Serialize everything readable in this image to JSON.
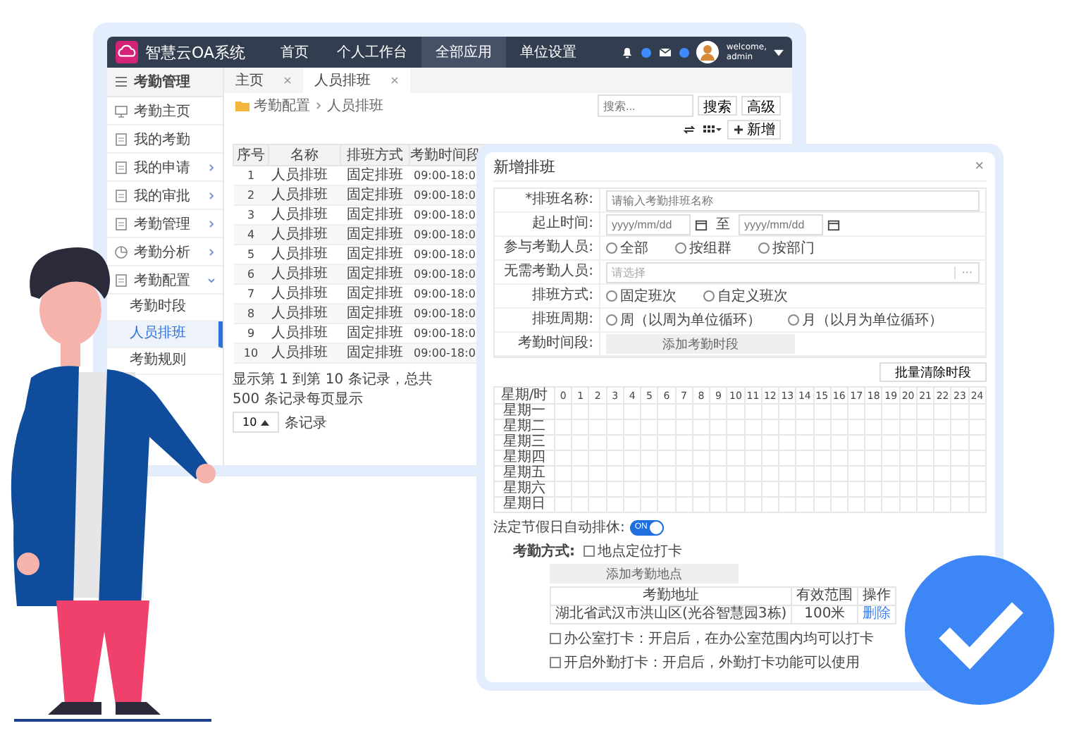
{
  "topbar": {
    "title": "智慧云OA系统",
    "nav": [
      {
        "label": "首页",
        "selected": false
      },
      {
        "label": "个人工作台",
        "selected": false
      },
      {
        "label": "全部应用",
        "selected": true
      },
      {
        "label": "单位设置",
        "selected": false
      }
    ],
    "user": {
      "greeting": "welcome,",
      "name": "admin"
    }
  },
  "sidebar": {
    "title": "考勤管理",
    "items": [
      {
        "label": "考勤主页",
        "kind": "link",
        "selected": false
      },
      {
        "label": "我的考勤",
        "kind": "link",
        "selected": false
      },
      {
        "label": "我的申请",
        "kind": "group",
        "expanded": false,
        "selected": false
      },
      {
        "label": "我的审批",
        "kind": "group",
        "expanded": false,
        "selected": false
      },
      {
        "label": "考勤管理",
        "kind": "group",
        "expanded": false,
        "selected": false
      },
      {
        "label": "考勤分析",
        "kind": "group",
        "expanded": false,
        "selected": false
      },
      {
        "label": "考勤配置",
        "kind": "group",
        "expanded": true,
        "selected": false,
        "children": [
          {
            "label": "考勤时段",
            "selected": false
          },
          {
            "label": "人员排班",
            "selected": true
          },
          {
            "label": "考勤规则",
            "selected": false
          }
        ]
      }
    ]
  },
  "tabs": [
    {
      "label": "主页",
      "selected": false
    },
    {
      "label": "人员排班",
      "selected": true
    }
  ],
  "breadcrumb": [
    "考勤配置",
    "人员排班"
  ],
  "search": {
    "placeholder": "搜索...",
    "button": "搜索",
    "advanced": "高级"
  },
  "toolbar": {
    "add": "新增"
  },
  "table": {
    "columns": [
      "序号",
      "名称",
      "排班方式",
      "考勤时间段"
    ],
    "rows": [
      [
        "1",
        "人员排班",
        "固定排班",
        "09:00-18:0"
      ],
      [
        "2",
        "人员排班",
        "固定排班",
        "09:00-18:0"
      ],
      [
        "3",
        "人员排班",
        "固定排班",
        "09:00-18:0"
      ],
      [
        "4",
        "人员排班",
        "固定排班",
        "09:00-18:0"
      ],
      [
        "5",
        "人员排班",
        "固定排班",
        "09:00-18:0"
      ],
      [
        "6",
        "人员排班",
        "固定排班",
        "09:00-18:0"
      ],
      [
        "7",
        "人员排班",
        "固定排班",
        "09:00-18:0"
      ],
      [
        "8",
        "人员排班",
        "固定排班",
        "09:00-18:0"
      ],
      [
        "9",
        "人员排班",
        "固定排班",
        "09:00-18:0"
      ],
      [
        "10",
        "人员排班",
        "固定排班",
        "09:00-18:0"
      ]
    ]
  },
  "pagination": {
    "summary": "显示第 1 到第 10 条记录，总共 500 条记录每页显示",
    "page_size": "10",
    "suffix": "条记录"
  },
  "dialog": {
    "title": "新增排班",
    "close": "×",
    "form": [
      {
        "kind": "text",
        "label": "*排班名称:",
        "placeholder": "请输入考勤排班名称"
      },
      {
        "kind": "daterange",
        "label": "起止时间:",
        "start_placeholder": "yyyy/mm/dd",
        "separator": "至",
        "end_placeholder": "yyyy/mm/dd"
      },
      {
        "kind": "radio",
        "label": "参与考勤人员:",
        "options": [
          {
            "label": "全部",
            "selected": false
          },
          {
            "label": "按组群",
            "selected": false
          },
          {
            "label": "按部门",
            "selected": false
          }
        ]
      },
      {
        "kind": "picker",
        "label": "无需考勤人员:",
        "placeholder": "请选择",
        "button": "···"
      },
      {
        "kind": "radio",
        "label": "排班方式:",
        "options": [
          {
            "label": "固定班次",
            "selected": false
          },
          {
            "label": "自定义班次",
            "selected": false
          }
        ]
      },
      {
        "kind": "radio",
        "label": "排班周期:",
        "options": [
          {
            "label": "周（以周为单位循环）",
            "selected": false
          },
          {
            "label": "月（以月为单位循环）",
            "selected": false
          }
        ]
      },
      {
        "kind": "button",
        "label": "考勤时间段:",
        "button": "添加考勤时段"
      }
    ],
    "clear_button": "批量清除时段",
    "grid": {
      "corner": "星期/时",
      "hours": [
        "0",
        "1",
        "2",
        "3",
        "4",
        "5",
        "6",
        "7",
        "8",
        "9",
        "10",
        "11",
        "12",
        "13",
        "14",
        "15",
        "16",
        "17",
        "18",
        "19",
        "20",
        "21",
        "22",
        "23",
        "24"
      ],
      "days": [
        "星期一",
        "星期二",
        "星期三",
        "星期四",
        "星期五",
        "星期六",
        "星期日"
      ]
    },
    "holiday": {
      "label": "法定节假日自动排休:",
      "on": true,
      "text": "ON"
    },
    "method": {
      "label": "考勤方式:",
      "location_checkbox": {
        "label": "地点定位打卡",
        "checked": false
      },
      "add_button": "添加考勤地点",
      "table": {
        "columns": [
          "考勤地址",
          "有效范围",
          "操作"
        ],
        "rows": [
          {
            "address": "湖北省武汉市洪山区(光谷智慧园3栋)",
            "range": "100米",
            "action": "删除"
          }
        ]
      },
      "options": [
        {
          "label": "办公室打卡：开启后，在办公室范围内均可以打卡",
          "checked": false
        },
        {
          "label": "开启外勤打卡：开启后，外勤打卡功能可以使用",
          "checked": false
        }
      ]
    }
  }
}
